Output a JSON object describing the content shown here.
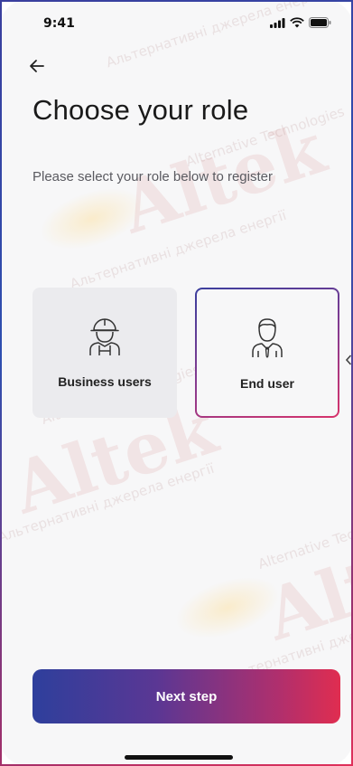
{
  "status_bar": {
    "time": "9:41"
  },
  "header": {
    "back_icon": "arrow-left-icon",
    "title": "Choose your role",
    "subtitle": "Please select your role below to register"
  },
  "roles": [
    {
      "label": "Business users",
      "icon": "worker-helmet-icon",
      "selected": false
    },
    {
      "label": "End user",
      "icon": "person-tie-icon",
      "selected": true
    }
  ],
  "footer": {
    "next_label": "Next step"
  },
  "watermark": {
    "brand": "Altek",
    "tagline_uk": "Альтернативні джерела енергії",
    "tagline_en": "Alternative Technologies"
  },
  "colors": {
    "gradient_start": "#2e3f9c",
    "gradient_mid": "#b02f6d",
    "gradient_end": "#e02d50",
    "background": "#f7f7f8",
    "card_background": "#ebebee"
  }
}
